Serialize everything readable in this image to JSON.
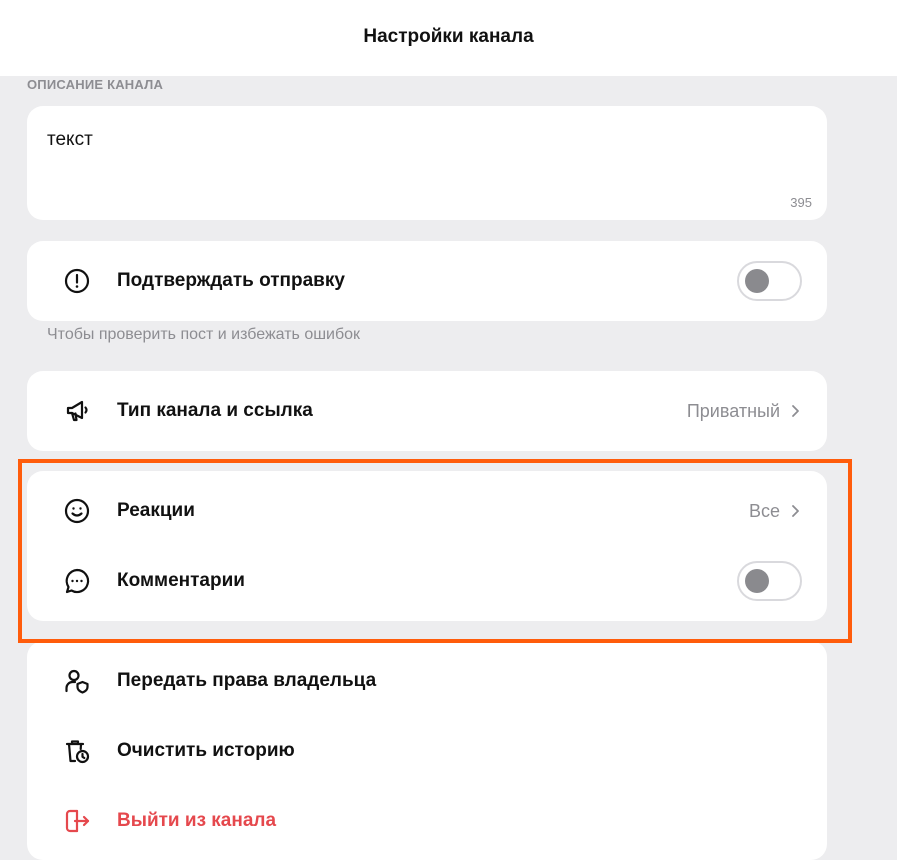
{
  "header": {
    "title": "Настройки канала"
  },
  "description": {
    "section_label": "ОПИСАНИЕ КАНАЛА",
    "value": "текст",
    "counter": "395"
  },
  "confirm": {
    "label": "Подтверждать отправку",
    "enabled": false,
    "hint": "Чтобы проверить пост и избежать ошибок"
  },
  "channel_type": {
    "label": "Тип канала и ссылка",
    "value": "Приватный"
  },
  "reactions": {
    "label": "Реакции",
    "value": "Все"
  },
  "comments": {
    "label": "Комментарии",
    "enabled": false
  },
  "actions": {
    "transfer_owner": "Передать права владельца",
    "clear_history": "Очистить историю",
    "leave_channel": "Выйти из канала"
  },
  "colors": {
    "highlight": "#ff5c0b",
    "danger": "#e5484d",
    "background": "#ededef"
  }
}
